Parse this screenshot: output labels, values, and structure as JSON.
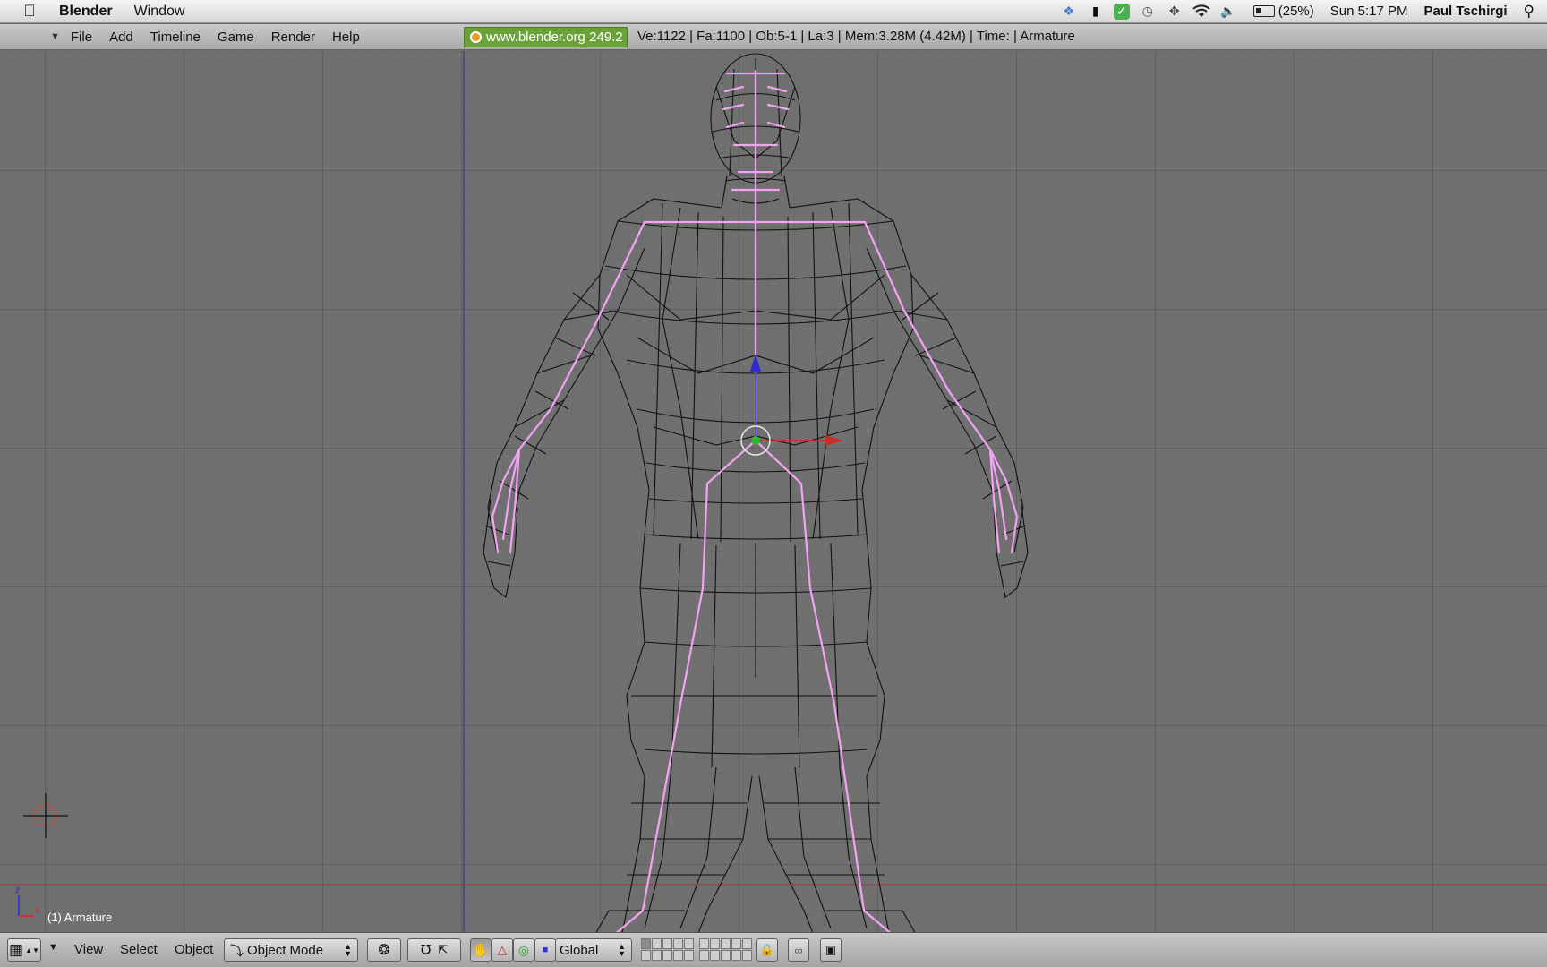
{
  "macos": {
    "app_name": "Blender",
    "menus": [
      "Window"
    ],
    "battery": "(25%)",
    "clock": "Sun 5:17 PM",
    "user": "Paul Tschirgi"
  },
  "blender_header": {
    "menus": [
      "File",
      "Add",
      "Timeline",
      "Game",
      "Render",
      "Help"
    ],
    "version": "www.blender.org 249.2",
    "stats": "Ve:1122 | Fa:1100 | Ob:5-1 | La:3  | Mem:3.28M (4.42M)  | Time: | Armature"
  },
  "viewport": {
    "object_label": "(1) Armature",
    "axis_labels": [
      "z",
      "x"
    ],
    "colors": {
      "grid_bg": "#707070",
      "grid_line": "#5f5f5f",
      "bone": "#f0a0f0",
      "mesh": "#111111",
      "x_axis": "#cc2222",
      "y_axis": "#2222cc",
      "z_axis": "#2222cc"
    }
  },
  "view3d_header": {
    "menus": [
      "View",
      "Select",
      "Object"
    ],
    "mode": "Object Mode",
    "orientation": "Global"
  }
}
